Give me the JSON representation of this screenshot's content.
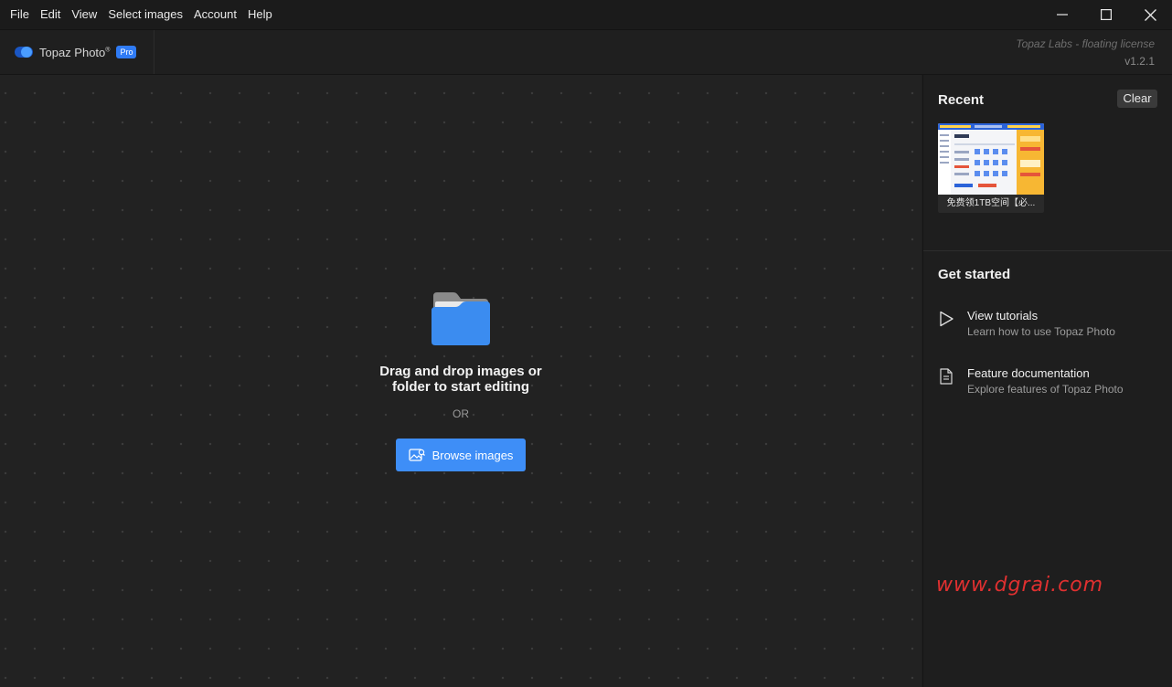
{
  "menu": {
    "items": [
      "File",
      "Edit",
      "View",
      "Select images",
      "Account",
      "Help"
    ]
  },
  "header": {
    "app_name": "Topaz Photo",
    "trademark": "®",
    "badge": "Pro",
    "license": "Topaz Labs - floating license",
    "version": "v1.2.1"
  },
  "drop_zone": {
    "line1": "Drag and drop images or",
    "line2": "folder to start editing",
    "or": "OR",
    "browse_label": "Browse images"
  },
  "recent": {
    "title": "Recent",
    "clear_label": "Clear",
    "items": [
      {
        "caption": "免费领1TB空间【必..."
      }
    ]
  },
  "get_started": {
    "title": "Get started",
    "items": [
      {
        "title": "View tutorials",
        "subtitle": "Learn how to use Topaz Photo",
        "icon": "play-icon"
      },
      {
        "title": "Feature documentation",
        "subtitle": "Explore features of Topaz Photo",
        "icon": "document-icon"
      }
    ]
  },
  "watermark": "www.dgrai.com",
  "colors": {
    "accent": "#3e8ef7",
    "badge": "#2f7bf5",
    "background": "#1e1e1e",
    "watermark": "#e03030"
  }
}
